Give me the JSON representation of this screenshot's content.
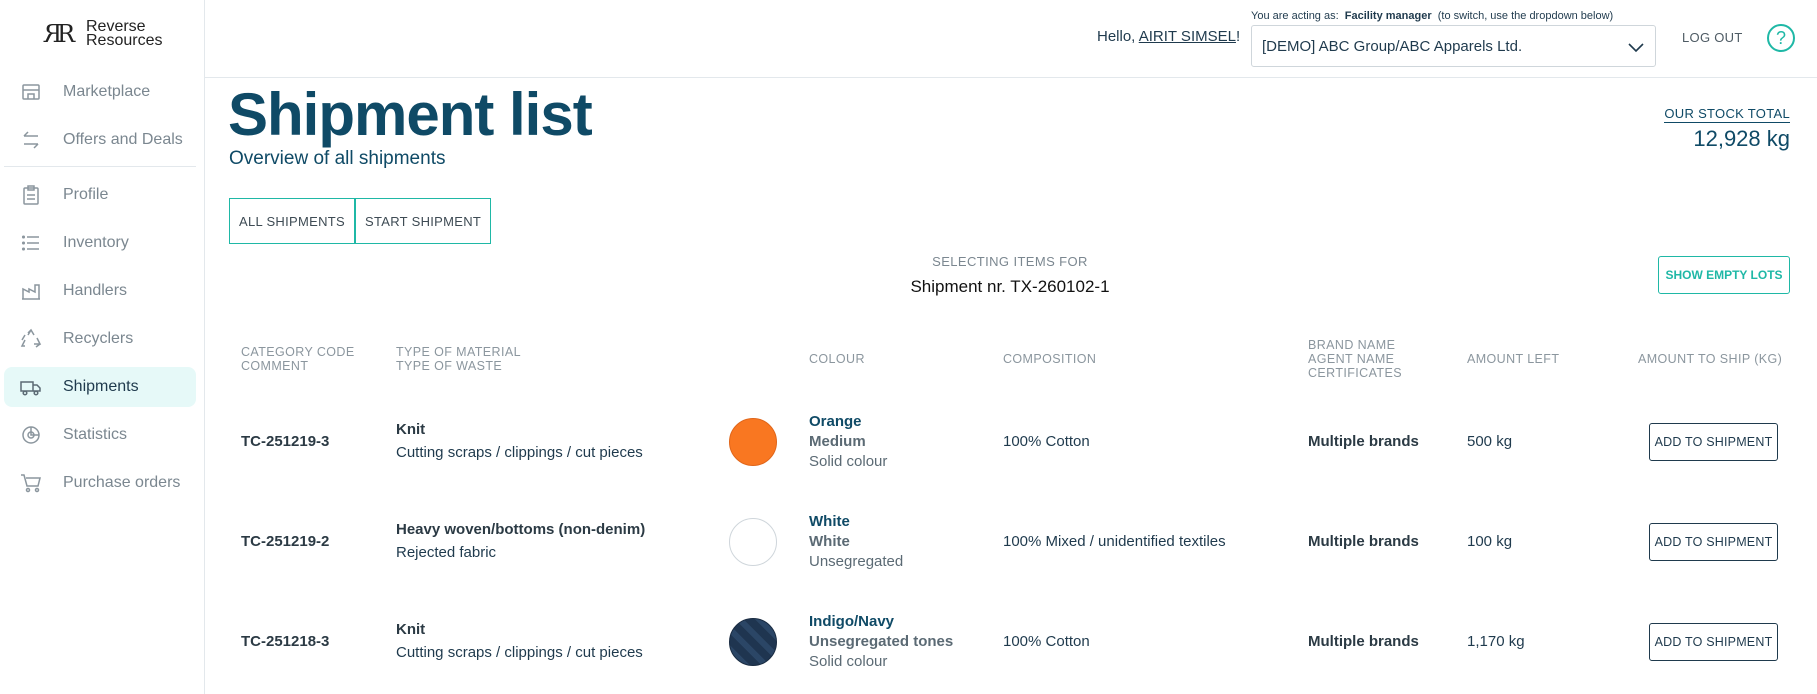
{
  "sidebar": {
    "logo_line1": "Reverse",
    "logo_line2": "Resources",
    "items": [
      {
        "label": "Marketplace",
        "icon": "store-icon"
      },
      {
        "label": "Offers and Deals",
        "icon": "arrows-swap-icon"
      },
      {
        "label": "Profile",
        "icon": "clipboard-icon"
      },
      {
        "label": "Inventory",
        "icon": "list-icon"
      },
      {
        "label": "Handlers",
        "icon": "factory-icon"
      },
      {
        "label": "Recyclers",
        "icon": "recycle-icon"
      },
      {
        "label": "Shipments",
        "icon": "truck-icon",
        "active": true
      },
      {
        "label": "Statistics",
        "icon": "pie-chart-icon"
      },
      {
        "label": "Purchase orders",
        "icon": "cart-icon"
      }
    ]
  },
  "header": {
    "hello_prefix": "Hello, ",
    "user_name": "AIRIT SIMSEL",
    "hello_suffix": "!",
    "acting_prefix": "You are acting as:",
    "acting_role": "Facility manager",
    "acting_suffix": "(to switch, use the dropdown below)",
    "org_selected": "[DEMO] ABC Group/ABC Apparels Ltd.",
    "logout": "LOG OUT",
    "help": "?"
  },
  "page": {
    "title": "Shipment list",
    "subtitle": "Overview of all shipments",
    "stock_label": "OUR STOCK TOTAL",
    "stock_value": "12,928 kg",
    "tabs": [
      "ALL SHIPMENTS",
      "START SHIPMENT"
    ],
    "selecting_label": "SELECTING ITEMS FOR",
    "shipment_nr": "Shipment nr. TX-260102-1",
    "show_empty": "SHOW EMPTY LOTS"
  },
  "table": {
    "headers": {
      "category_code": "CATEGORY CODE",
      "comment": "COMMENT",
      "type_material": "TYPE OF MATERIAL",
      "type_waste": "TYPE OF WASTE",
      "colour": "COLOUR",
      "composition": "COMPOSITION",
      "brand_name": "BRAND NAME",
      "agent_name": "AGENT NAME",
      "certificates": "CERTIFICATES",
      "amount_left": "AMOUNT LEFT",
      "amount_to_ship": "AMOUNT TO SHIP (KG)"
    },
    "rows": [
      {
        "code": "TC-251219-3",
        "material": "Knit",
        "waste": "Cutting scraps / clippings / cut pieces",
        "colour": "Orange",
        "shade": "Medium",
        "pattern": "Solid colour",
        "swatch": "#f97721",
        "composition": "100%  Cotton",
        "brand": "Multiple brands",
        "amount": "500 kg",
        "action": "ADD TO SHIPMENT"
      },
      {
        "code": "TC-251219-2",
        "material": "Heavy woven/bottoms (non-denim)",
        "waste": "Rejected fabric",
        "colour": "White",
        "shade": "White",
        "pattern": "Unsegregated",
        "swatch": "#ffffff",
        "composition": "100%  Mixed / unidentified textiles",
        "brand": "Multiple brands",
        "amount": "100 kg",
        "action": "ADD TO SHIPMENT"
      },
      {
        "code": "TC-251218-3",
        "material": "Knit",
        "waste": "Cutting scraps / clippings / cut pieces",
        "colour": "Indigo/Navy",
        "shade": "Unsegregated tones",
        "pattern": "Solid colour",
        "swatch": "#1f3550",
        "composition": "100%  Cotton",
        "brand": "Multiple brands",
        "amount": "1,170 kg",
        "action": "ADD TO SHIPMENT"
      }
    ]
  }
}
